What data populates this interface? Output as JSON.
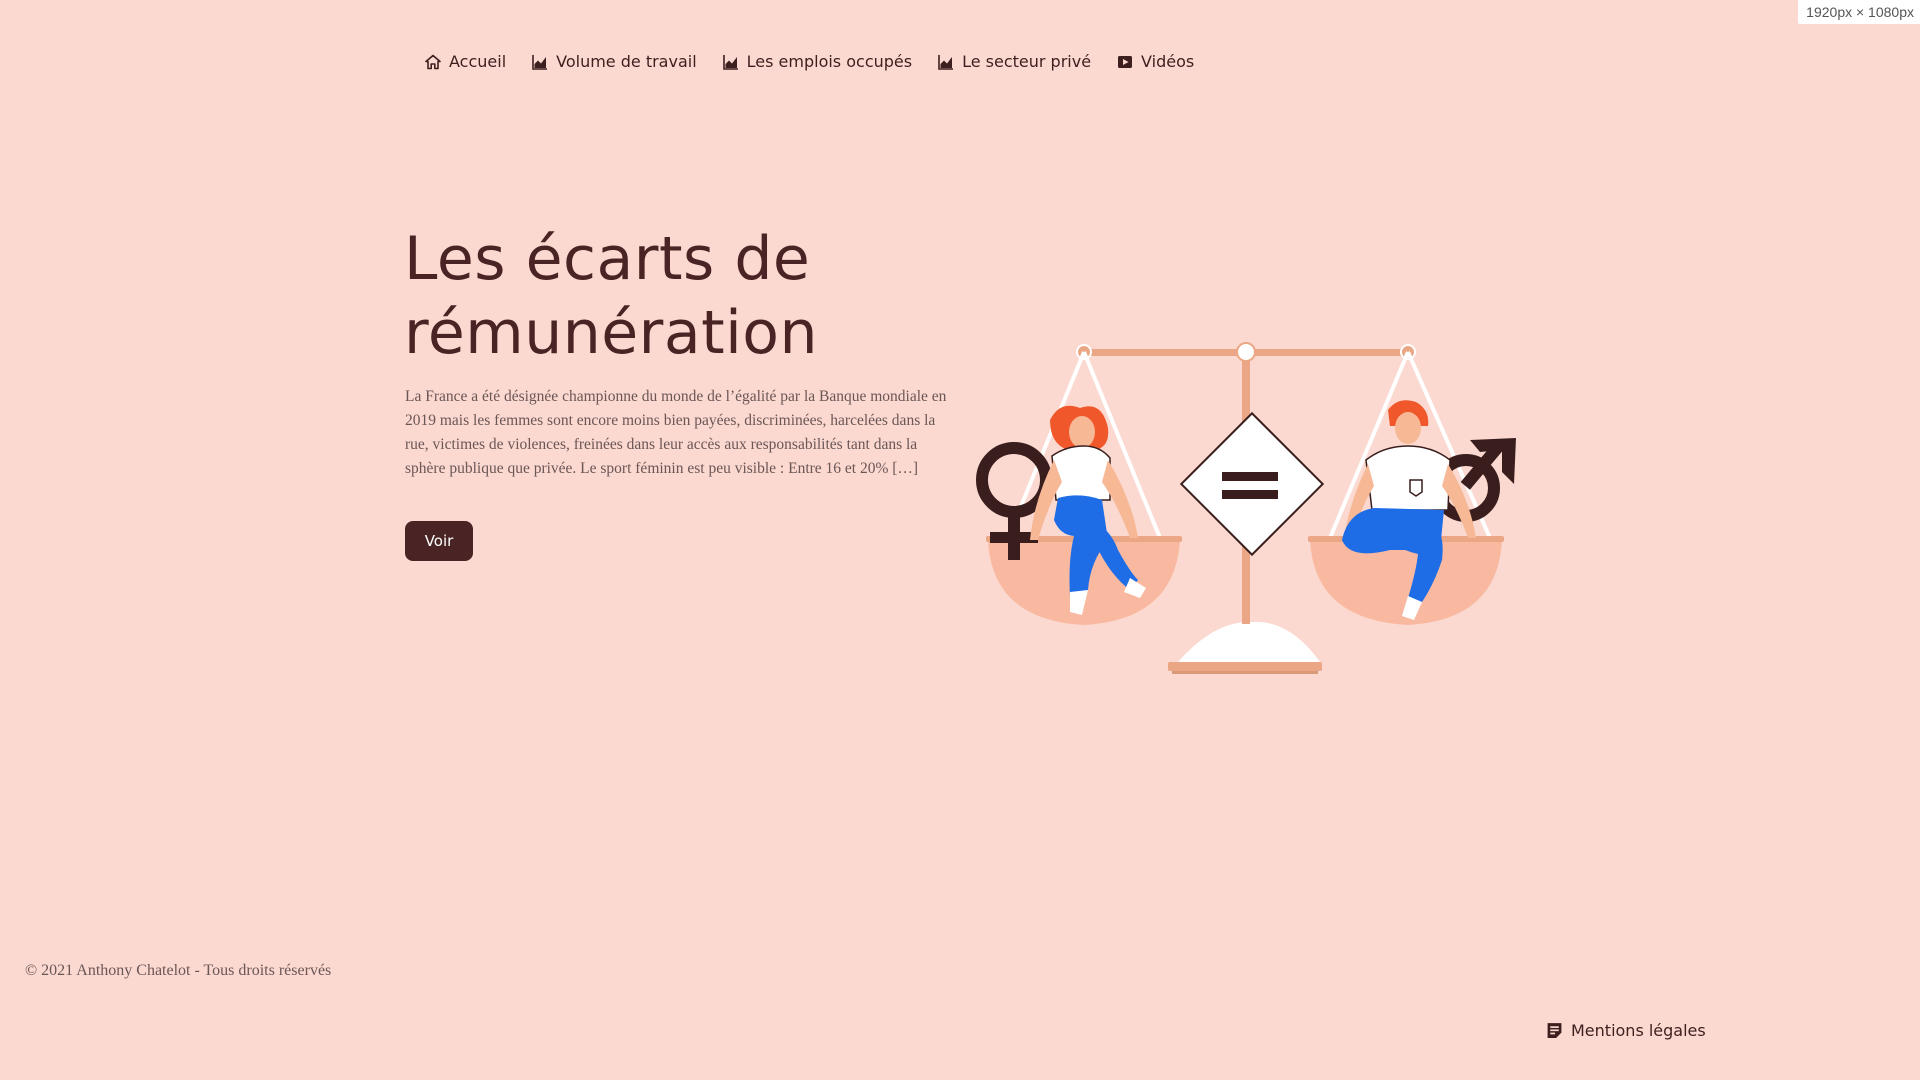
{
  "viewport_badge": "1920px × 1080px",
  "nav": {
    "items": [
      {
        "label": "Accueil",
        "icon": "home-icon"
      },
      {
        "label": "Volume de travail",
        "icon": "area-chart-icon"
      },
      {
        "label": "Les emplois occupés",
        "icon": "area-chart-icon"
      },
      {
        "label": "Le secteur privé",
        "icon": "area-chart-icon"
      },
      {
        "label": "Vidéos",
        "icon": "play-icon"
      }
    ]
  },
  "hero": {
    "title_line1": "Les écarts de",
    "title_line2": "rémunération",
    "text": "La France a été désignée championne du monde de l’égalité par la Banque mondiale en 2019 mais les femmes sont encore moins bien payées, discriminées, harcelées dans la rue, victimes de violences, freinées dans leur accès aux responsabilités tant dans la sphère publique que privée. Le sport féminin est peu visible : Entre 16 et 20% […]",
    "button_label": "Voir",
    "illustration_icon": "equality-scale-illustration"
  },
  "footer": {
    "copyright": "© 2021 Anthony Chatelot - Tous droits réservés",
    "legal_label": "Mentions légales",
    "legal_icon": "document-icon"
  },
  "colors": {
    "background": "#fbd9d0",
    "primary": "#4a2424",
    "accent": "#eba785",
    "blue": "#1f6de6",
    "hair": "#f0582b"
  }
}
